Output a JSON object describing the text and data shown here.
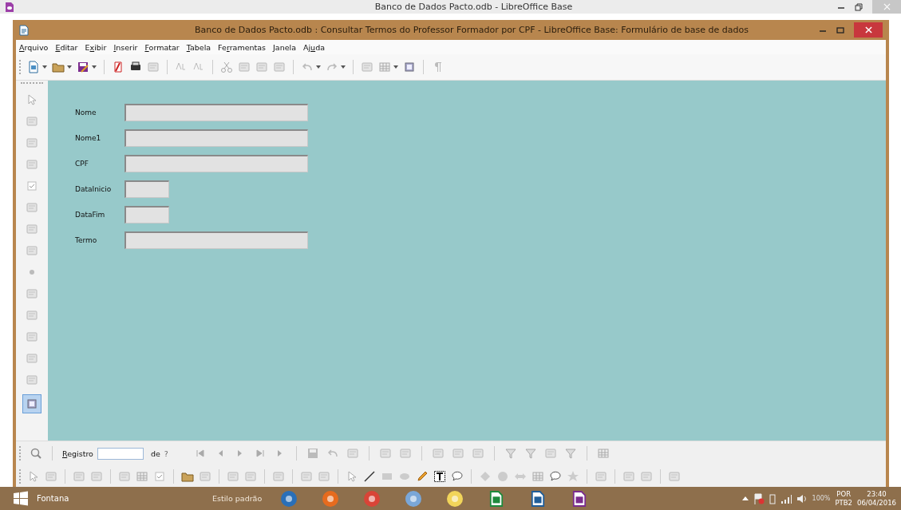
{
  "outer_window": {
    "title": "Banco de Dados Pacto.odb - LibreOffice Base"
  },
  "window": {
    "title": "Banco de Dados Pacto.odb : Consultar Termos do Professor Formador por CPF - LibreOffice Base: Formulário de base de dados"
  },
  "menu": [
    {
      "key": "A",
      "after": "rquivo"
    },
    {
      "key": "E",
      "after": "ditar"
    },
    {
      "before": "E",
      "key": "x",
      "after": "ibir"
    },
    {
      "key": "I",
      "after": "nserir"
    },
    {
      "key": "F",
      "after": "ormatar"
    },
    {
      "key": "T",
      "after": "abela"
    },
    {
      "before": "Fe",
      "key": "r",
      "after": "ramentas"
    },
    {
      "key": "J",
      "after": "anela"
    },
    {
      "before": "Aj",
      "key": "u",
      "after": "da"
    }
  ],
  "form": {
    "fields": [
      {
        "label": "Nome",
        "kind": "wide"
      },
      {
        "label": "Nome1",
        "kind": "wide"
      },
      {
        "label": "CPF",
        "kind": "wide"
      },
      {
        "label": "DataInicio",
        "kind": "short"
      },
      {
        "label": "DataFim",
        "kind": "short"
      },
      {
        "label": "Termo",
        "kind": "wide"
      }
    ]
  },
  "navigation": {
    "label_key": "R",
    "label_after": "egistro",
    "of": "de",
    "total": "?"
  },
  "status_bar": {
    "page": "Fontana",
    "style": "Estilo padrão"
  },
  "taskbar": {
    "language": "POR",
    "layout": "PTB2",
    "time": "23:40",
    "date": "06/04/2016",
    "zoom": "100%"
  }
}
